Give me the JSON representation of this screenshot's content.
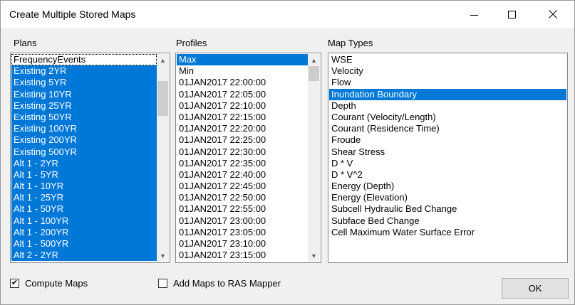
{
  "window": {
    "title": "Create Multiple Stored Maps",
    "minimize_icon": "minimize-icon",
    "maximize_icon": "maximize-icon",
    "close_icon": "close-icon"
  },
  "plans": {
    "label": "Plans",
    "items": [
      {
        "label": "FrequencyEvents",
        "selected": false
      },
      {
        "label": "Existing 2YR",
        "selected": true
      },
      {
        "label": "Existing 5YR",
        "selected": true
      },
      {
        "label": "Existing 10YR",
        "selected": true
      },
      {
        "label": "Existing 25YR",
        "selected": true
      },
      {
        "label": "Existing 50YR",
        "selected": true
      },
      {
        "label": "Existing 100YR",
        "selected": true
      },
      {
        "label": "Existing 200YR",
        "selected": true
      },
      {
        "label": "Existing 500YR",
        "selected": true
      },
      {
        "label": "Alt 1 - 2YR",
        "selected": true
      },
      {
        "label": "Alt 1 - 5YR",
        "selected": true
      },
      {
        "label": "Alt 1 - 10YR",
        "selected": true
      },
      {
        "label": "Alt 1 - 25YR",
        "selected": true
      },
      {
        "label": "Alt 1 - 50YR",
        "selected": true
      },
      {
        "label": "Alt 1 - 100YR",
        "selected": true
      },
      {
        "label": "Alt 1 - 200YR",
        "selected": true
      },
      {
        "label": "Alt 1 - 500YR",
        "selected": true
      },
      {
        "label": "Alt 2 - 2YR",
        "selected": true
      }
    ],
    "scrollbar": {
      "thumb_fraction_start": 0.08,
      "thumb_fraction_size": 0.19
    }
  },
  "profiles": {
    "label": "Profiles",
    "items": [
      {
        "label": "Max",
        "selected": true
      },
      {
        "label": "Min",
        "selected": false
      },
      {
        "label": "01JAN2017 22:00:00",
        "selected": false
      },
      {
        "label": "01JAN2017 22:05:00",
        "selected": false
      },
      {
        "label": "01JAN2017 22:10:00",
        "selected": false
      },
      {
        "label": "01JAN2017 22:15:00",
        "selected": false
      },
      {
        "label": "01JAN2017 22:20:00",
        "selected": false
      },
      {
        "label": "01JAN2017 22:25:00",
        "selected": false
      },
      {
        "label": "01JAN2017 22:30:00",
        "selected": false
      },
      {
        "label": "01JAN2017 22:35:00",
        "selected": false
      },
      {
        "label": "01JAN2017 22:40:00",
        "selected": false
      },
      {
        "label": "01JAN2017 22:45:00",
        "selected": false
      },
      {
        "label": "01JAN2017 22:50:00",
        "selected": false
      },
      {
        "label": "01JAN2017 22:55:00",
        "selected": false
      },
      {
        "label": "01JAN2017 23:00:00",
        "selected": false
      },
      {
        "label": "01JAN2017 23:05:00",
        "selected": false
      },
      {
        "label": "01JAN2017 23:10:00",
        "selected": false
      },
      {
        "label": "01JAN2017 23:15:00",
        "selected": false
      }
    ],
    "scrollbar": {
      "thumb_fraction_start": 0.0,
      "thumb_fraction_size": 0.08
    }
  },
  "map_types": {
    "label": "Map Types",
    "items": [
      {
        "label": "WSE",
        "selected": false
      },
      {
        "label": "Velocity",
        "selected": false
      },
      {
        "label": "Flow",
        "selected": false
      },
      {
        "label": "Inundation Boundary",
        "selected": true
      },
      {
        "label": "Depth",
        "selected": false
      },
      {
        "label": "Courant (Velocity/Length)",
        "selected": false
      },
      {
        "label": "Courant (Residence Time)",
        "selected": false
      },
      {
        "label": "Froude",
        "selected": false
      },
      {
        "label": "Shear Stress",
        "selected": false
      },
      {
        "label": "D * V",
        "selected": false
      },
      {
        "label": "D * V^2",
        "selected": false
      },
      {
        "label": "Energy (Depth)",
        "selected": false
      },
      {
        "label": "Energy (Elevation)",
        "selected": false
      },
      {
        "label": "Subcell Hydraulic Bed Change",
        "selected": false
      },
      {
        "label": "Subface Bed Change",
        "selected": false
      },
      {
        "label": "Cell Maximum Water Surface Error",
        "selected": false
      }
    ]
  },
  "options": {
    "compute_maps": {
      "label": "Compute Maps",
      "checked": true
    },
    "add_to_ras_mapper": {
      "label": "Add Maps to RAS Mapper",
      "checked": false
    }
  },
  "ok_button": {
    "label": "OK"
  },
  "colors": {
    "selection": "#0078d7",
    "background": "#f0f0f0"
  }
}
